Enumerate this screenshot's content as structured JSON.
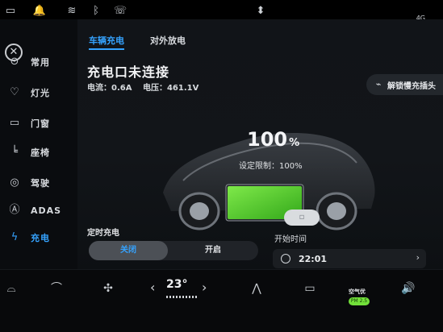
{
  "tabs": [
    {
      "label": "车辆充电",
      "active": true
    },
    {
      "label": "对外放电",
      "active": false
    }
  ],
  "sidebar": {
    "items": [
      {
        "label": "常用",
        "icon": "toggle-icon"
      },
      {
        "label": "灯光",
        "icon": "bulb-icon"
      },
      {
        "label": "门窗",
        "icon": "door-icon"
      },
      {
        "label": "座椅",
        "icon": "seat-icon"
      },
      {
        "label": "驾驶",
        "icon": "steering-wheel-icon"
      },
      {
        "label": "ADAS",
        "icon": "adas-icon"
      },
      {
        "label": "充电",
        "icon": "charging-plug-icon",
        "active": true
      }
    ]
  },
  "charging": {
    "status_title": "充电口未连接",
    "current": "电流：0.6A",
    "voltage": "电压：461.1V",
    "unlock_label": "解锁慢充插头",
    "percent": "100",
    "percent_unit": "%",
    "limit_text": "设定限制：100%",
    "level": 1.0
  },
  "schedule": {
    "label": "定时充电",
    "off_label": "关闭",
    "on_label": "开启",
    "selected": "off",
    "start_label": "开始时间",
    "start_time": "22:01"
  },
  "dock": {
    "temperature": "23°",
    "air_label": "空气优",
    "air_badge": "PM 2.5"
  },
  "status": {
    "signal": "4G"
  },
  "colors": {
    "accent": "#35a3ff",
    "battery": "#58d62d",
    "air_badge": "#72e03a"
  }
}
